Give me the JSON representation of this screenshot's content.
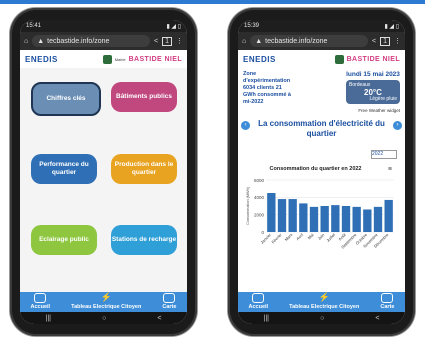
{
  "left_phone": {
    "status_time": "15:41",
    "url": "tecbastide.info/zone",
    "tab_count": "1",
    "logo": "ENEDIS",
    "partner_label": "Mairie",
    "brand": "BASTIDE NIEL",
    "tiles": [
      {
        "label": "Chiffres clés",
        "color": "#6b8fb4",
        "outline": true
      },
      {
        "label": "Bâtiments publics",
        "color": "#c0487f"
      },
      {
        "label": "Performance du quartier",
        "color": "#2f6fb5"
      },
      {
        "label": "Production dans le quartier",
        "color": "#e8a321"
      },
      {
        "label": "Eclairage public",
        "color": "#8ec63f"
      },
      {
        "label": "Stations de recharge",
        "color": "#2f9fd8"
      }
    ],
    "nav": [
      "Accueil",
      "Tableau Electrique Citoyen",
      "Carte"
    ]
  },
  "right_phone": {
    "status_time": "15:39",
    "url": "tecbastide.info/zone",
    "tab_count": "1",
    "logo": "ENEDIS",
    "brand": "BASTIDE NIEL",
    "zone_text": "Zone d'expérimentation 6034 clients 21 GWh consommé à mi-2022",
    "date": "lundi 15 mai 2023",
    "weather_city": "Bordeaux",
    "weather_temp": "20°C",
    "weather_desc": "Légère pluie",
    "weather_widget": "Free Weather widget",
    "chart_title": "La consommation d'électricité du quartier",
    "year_select": "2022",
    "nav": [
      "Accueil",
      "Tableau Electrique Citoyen",
      "Carte"
    ]
  },
  "chart_data": {
    "type": "bar",
    "title": "Consommation du quartier en 2022",
    "ylabel": "Consommation (MWh)",
    "ylim": [
      0,
      6000
    ],
    "yticks": [
      "0",
      "2000",
      "4000",
      "6000"
    ],
    "categories": [
      "Janvier",
      "Février",
      "Mars",
      "Avril",
      "Mai",
      "Juin",
      "Juillet",
      "Août",
      "Septembre",
      "Octobre",
      "Novembre",
      "Décembre"
    ],
    "values": [
      4500,
      3800,
      3800,
      3300,
      2900,
      3000,
      3100,
      3000,
      2900,
      2600,
      2900,
      3700
    ],
    "bar_color": "#2f6fb5"
  },
  "accent": "#3d8dd8"
}
